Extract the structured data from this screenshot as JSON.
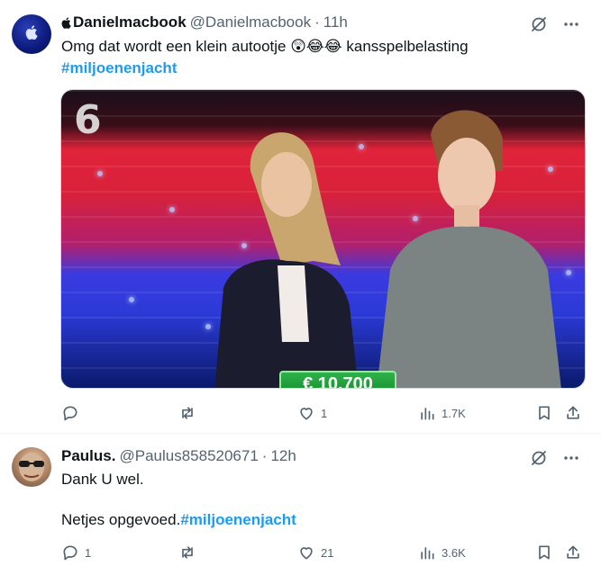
{
  "tweets": [
    {
      "author_name": "Danielmacbook",
      "handle": "@Danielmacbook",
      "separator": "·",
      "time": "11h",
      "text": "Omg dat wordt een klein autootje 😲😂😂 kansspelbelasting",
      "hashtag": "#miljoenenjacht",
      "media": {
        "channel_logo": "6",
        "prize_banner": "€ 10.700"
      },
      "actions": {
        "reply": "",
        "repost": "",
        "like": "1",
        "views": "1.7K"
      },
      "icons": [
        "apple-icon",
        "grok-icon",
        "more-icon",
        "reply-icon",
        "repost-icon",
        "like-icon",
        "views-icon",
        "bookmark-icon",
        "share-icon"
      ]
    },
    {
      "author_name": "Paulus.",
      "handle": "@Paulus858520671",
      "separator": "·",
      "time": "12h",
      "text_line1": "Dank U wel.",
      "text_line2": "Netjes opgevoed.",
      "hashtag": "#miljoenenjacht",
      "actions": {
        "reply": "1",
        "repost": "",
        "like": "21",
        "views": "3.6K"
      }
    }
  ],
  "colors": {
    "text": "#0f1419",
    "muted": "#536471",
    "link": "#1d9bf0",
    "border": "#eff3f4"
  }
}
